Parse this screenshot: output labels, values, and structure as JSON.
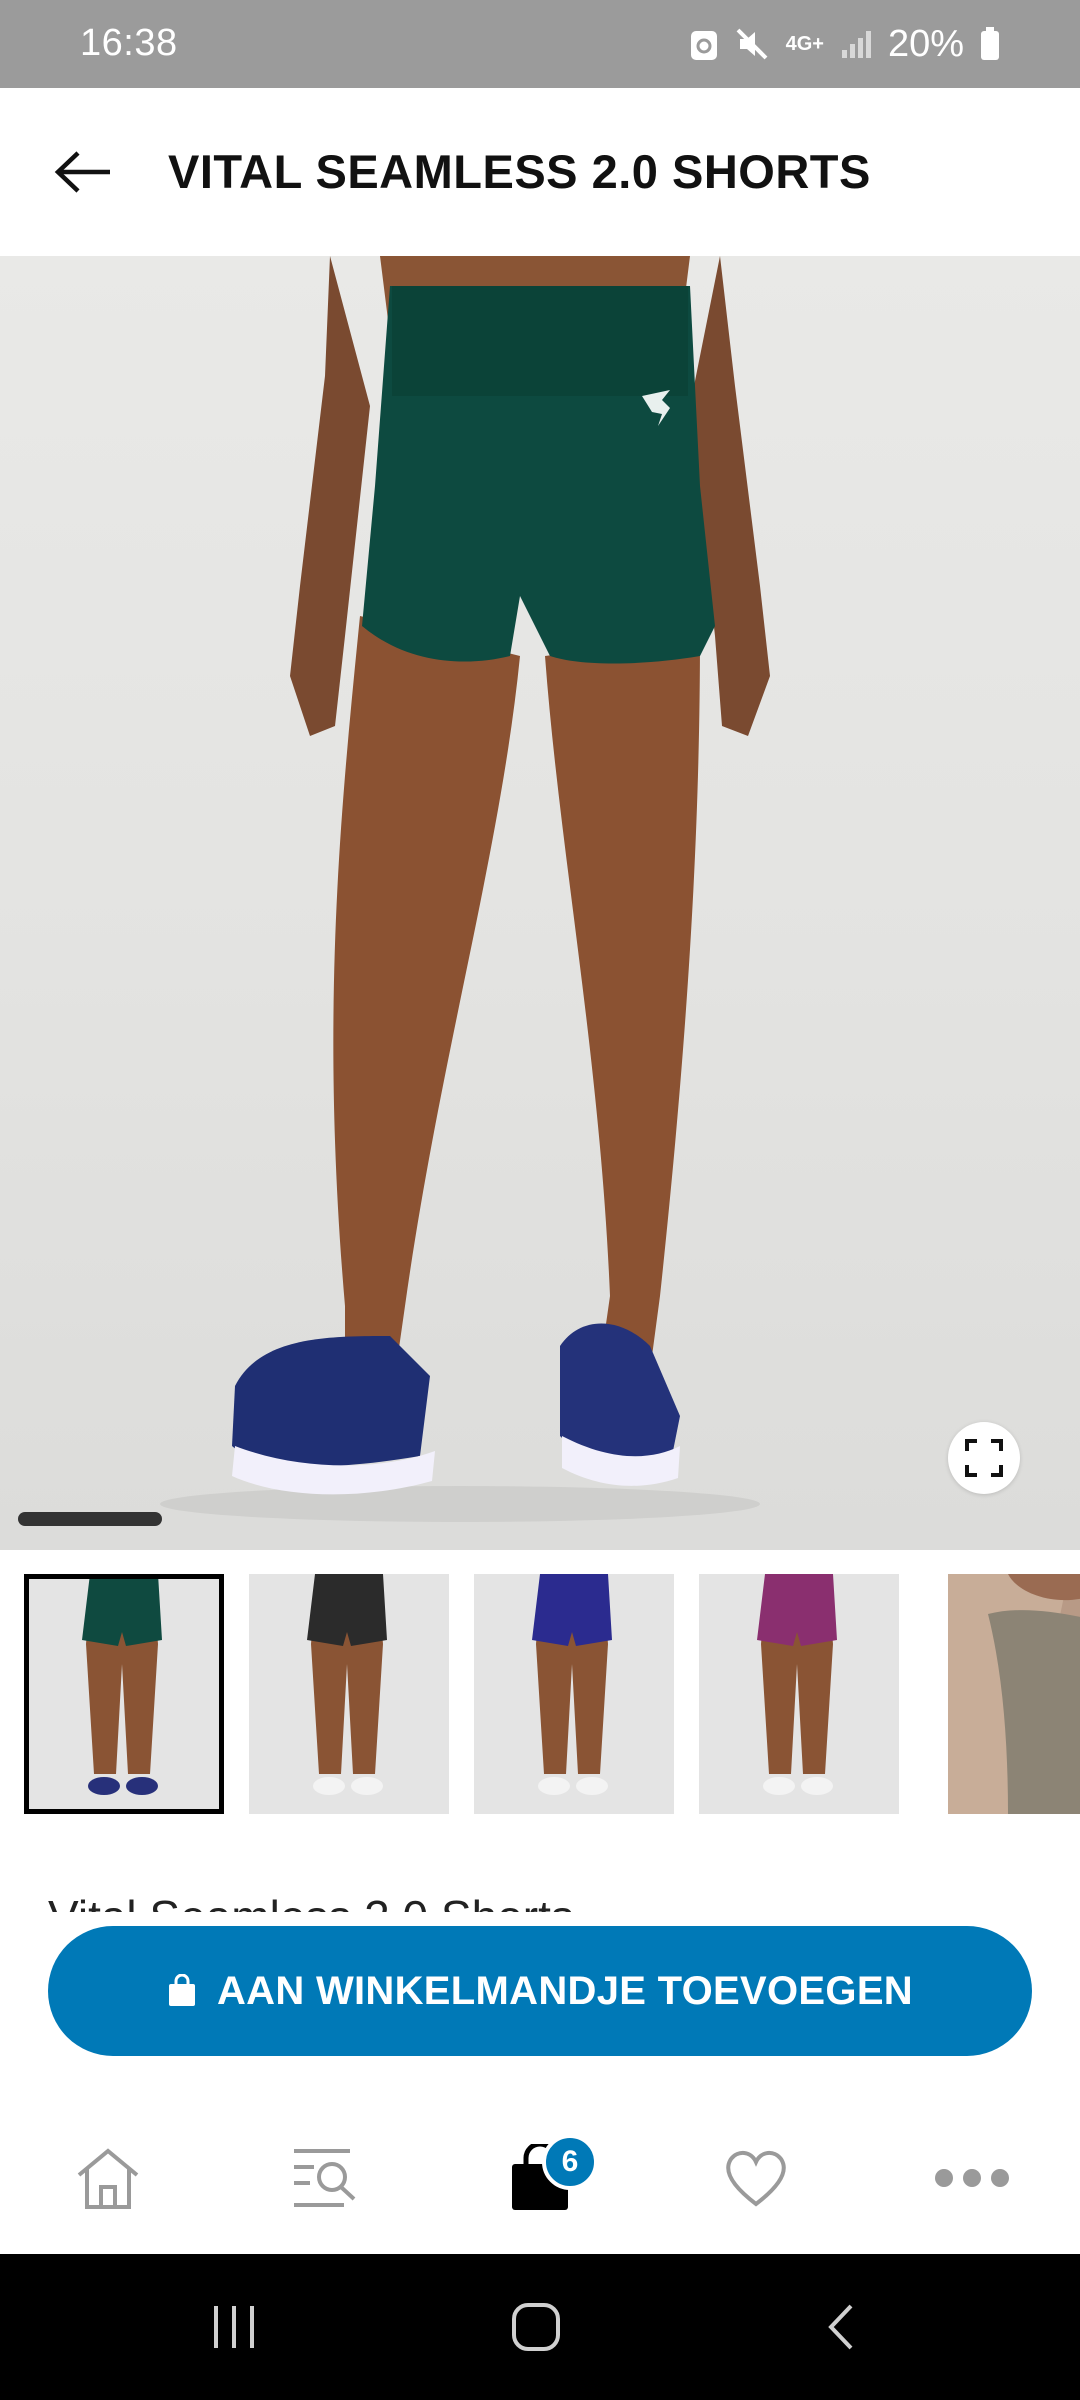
{
  "status_bar": {
    "time": "16:38",
    "network": "4G+",
    "battery": "20%",
    "icons": [
      "recycle-icon",
      "mute-icon",
      "network-4g-icon",
      "signal-icon",
      "battery-icon"
    ]
  },
  "header": {
    "title": "VITAL SEAMLESS 2.0 SHORTS",
    "back_icon": "arrow-left-icon"
  },
  "hero": {
    "fullscreen_icon": "fullscreen-icon",
    "image_index": 1,
    "image_count": 5
  },
  "thumbnails": [
    {
      "color_name": "green",
      "color": "#0f4a40",
      "selected": true
    },
    {
      "color_name": "black",
      "color": "#2b2b2b",
      "selected": false
    },
    {
      "color_name": "blue",
      "color": "#2b2b8f",
      "selected": false
    },
    {
      "color_name": "magenta",
      "color": "#8a2f6f",
      "selected": false
    },
    {
      "color_name": "taupe",
      "color": "#8c8475",
      "selected": false
    }
  ],
  "product": {
    "name": "Vital Seamless 2.0 Shorts"
  },
  "add_to_cart": {
    "label": "AAN WINKELMANDJE TOEVOEGEN",
    "icon": "shopping-bag-icon",
    "color": "#0079b7"
  },
  "bottom_nav": {
    "items": [
      "home-icon",
      "search-menu-icon",
      "bag-icon",
      "heart-icon",
      "more-icon"
    ],
    "cart_count": "6"
  },
  "system_nav": [
    "recents-icon",
    "home-circle-icon",
    "back-chevron-icon"
  ]
}
